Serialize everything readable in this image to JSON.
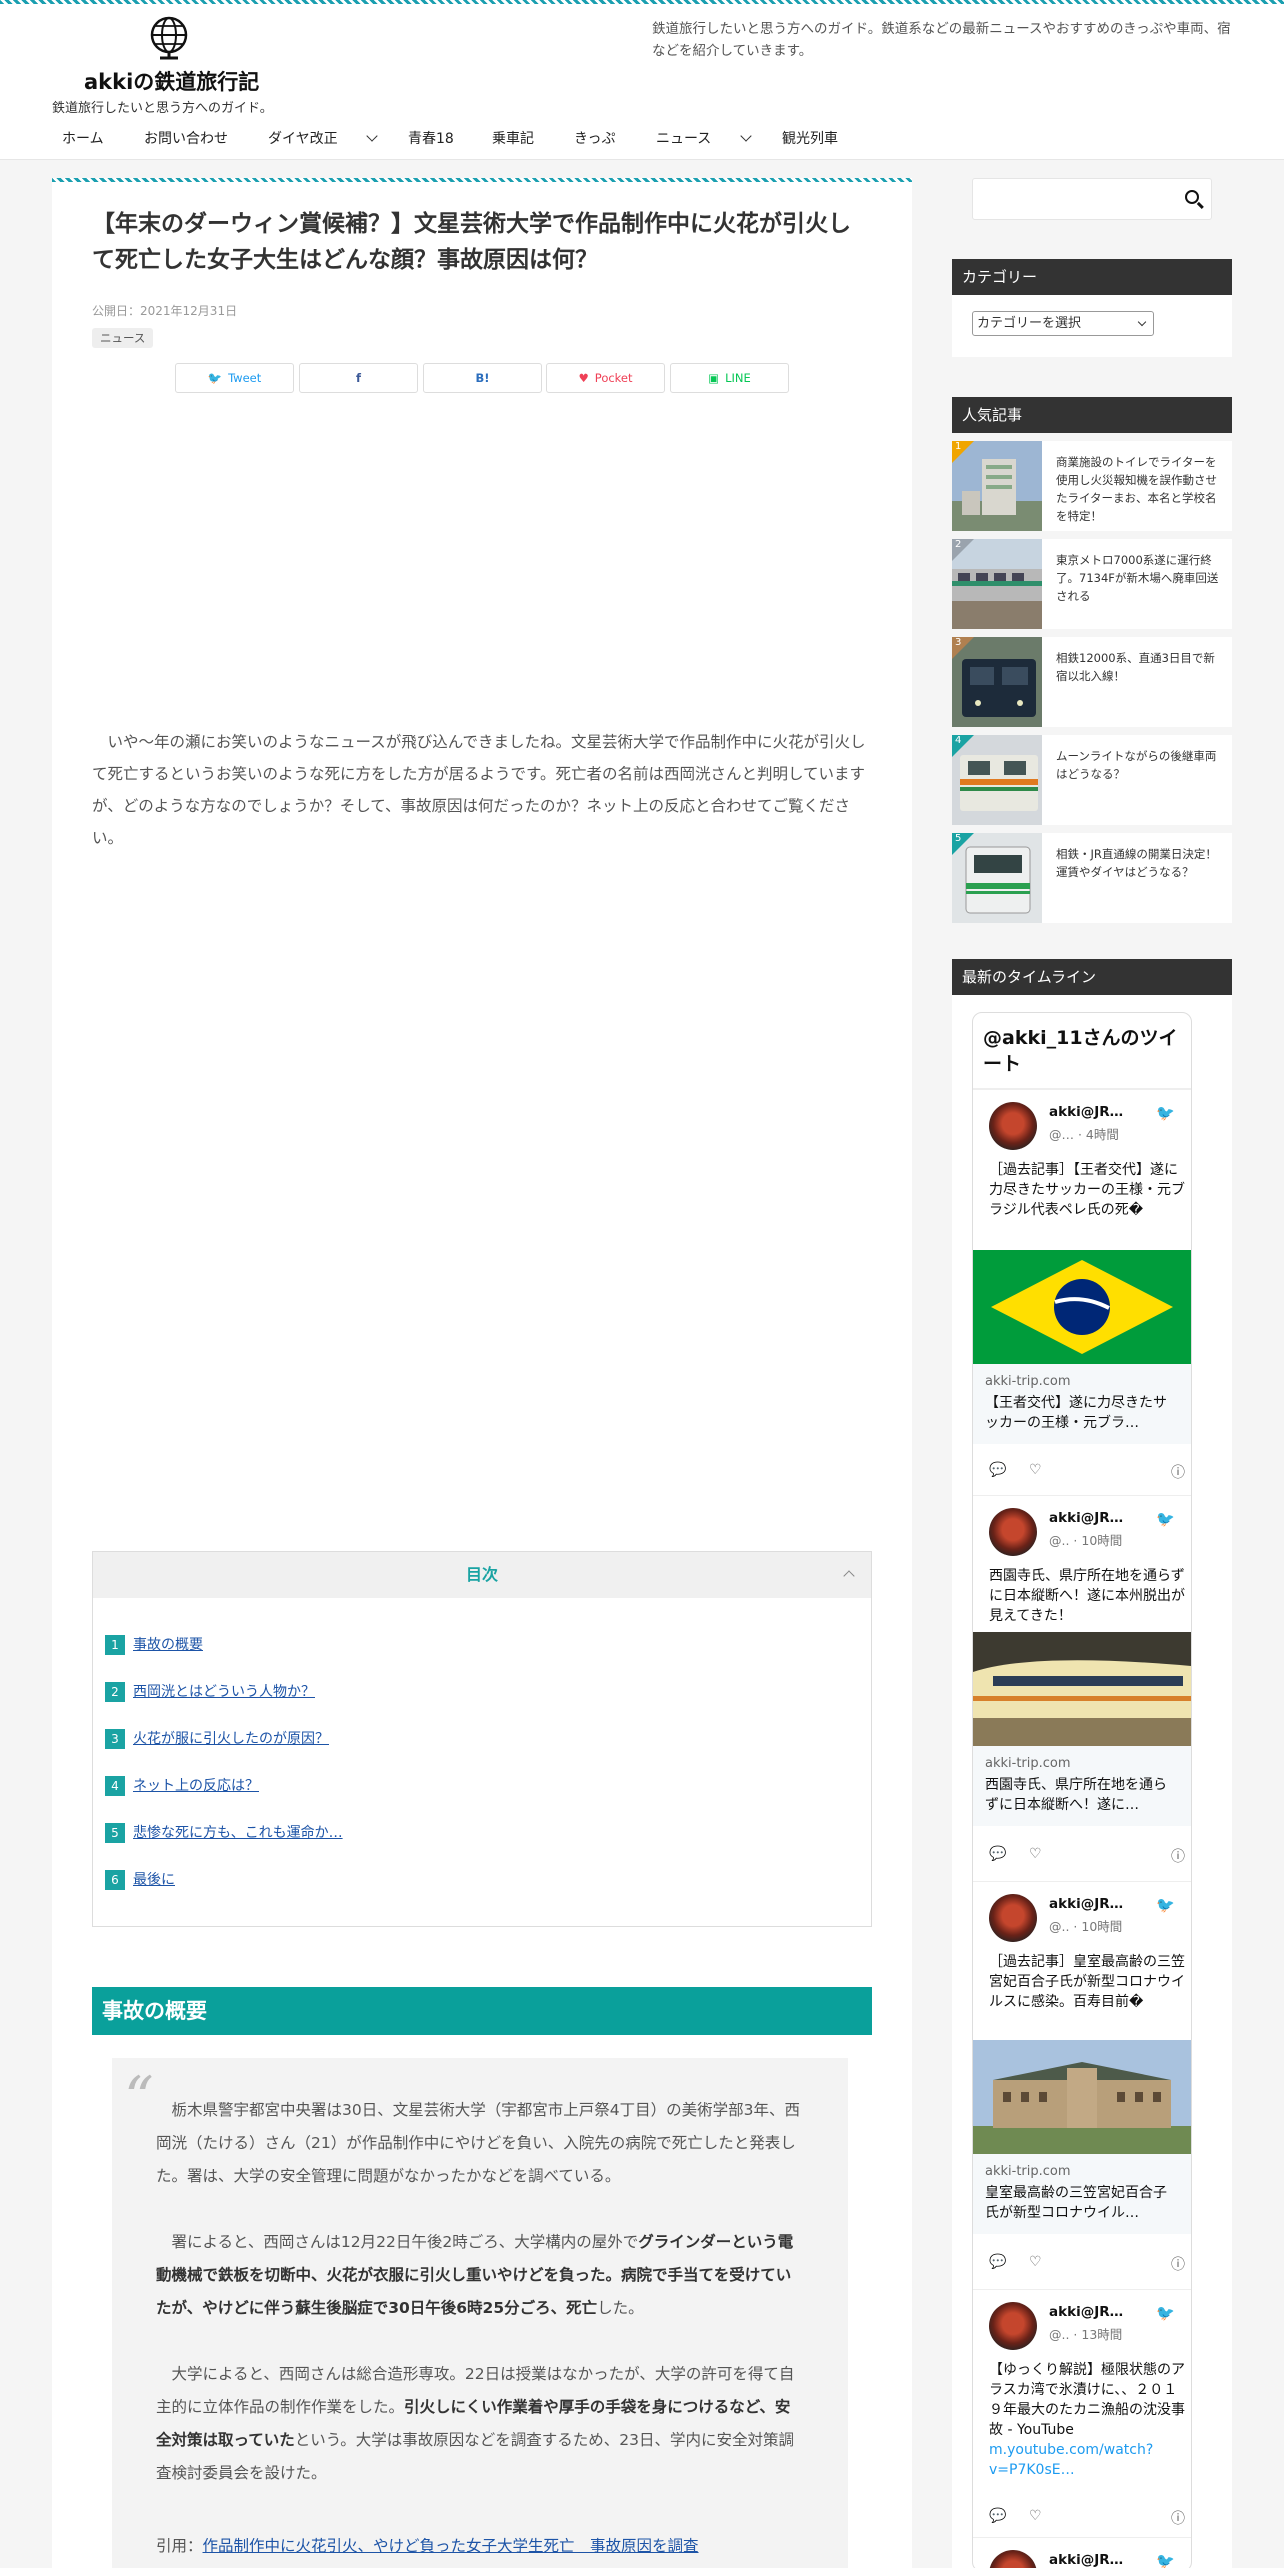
{
  "header": {
    "site_title": "akkiの鉄道旅行記",
    "tagline": "鉄道旅行したいと思う方へのガイド。",
    "description": "鉄道旅行したいと思う方へのガイド。鉄道系などの最新ニュースやおすすめのきっぷや車両、宿などを紹介していきます。"
  },
  "nav": {
    "items": [
      "ホーム",
      "お問い合わせ",
      "ダイヤ改正",
      "青春18",
      "乗車記",
      "きっぷ",
      "ニュース",
      "観光列車"
    ]
  },
  "article": {
    "title": "【年末のダーウィン賞候補？】文星芸術大学で作品制作中に火花が引火して死亡した女子大生はどんな顔？事故原因は何？",
    "date": "公開日：2021年12月31日",
    "category": "ニュース",
    "share": [
      "Tweet",
      "",
      "B!",
      "Pocket",
      "LINE"
    ],
    "intro": "いや～年の瀬にお笑いのようなニュースが飛び込んできましたね。文星芸術大学で作品制作中に火花が引火して死亡するというお笑いのような死に方をした方が居るようです。死亡者の名前は西岡洸さんと判明していますが、どのような方なのでしょうか？そして、事故原因は何だったのか？ネット上の反応と合わせてご覧ください。"
  },
  "toc": {
    "title": "目次",
    "items": [
      {
        "num": "1",
        "label": "事故の概要"
      },
      {
        "num": "2",
        "label": "西岡洸とはどういう人物か？"
      },
      {
        "num": "3",
        "label": "火花が服に引火したのが原因？"
      },
      {
        "num": "4",
        "label": "ネット上の反応は？"
      },
      {
        "num": "5",
        "label": "悲惨な死に方も、これも運命か…"
      },
      {
        "num": "6",
        "label": "最後に"
      }
    ]
  },
  "section": {
    "heading": "事故の概要",
    "quote_p1": "栃木県警宇都宮中央署は30日、文星芸術大学（宇都宮市上戸祭4丁目）の美術学部3年、西岡洸（たける）さん（21）が作品制作中にやけどを負い、入院先の病院で死亡したと発表した。署は、大学の安全管理に問題がなかったかなどを調べている。",
    "quote_p2a": "署によると、西岡さんは12月22日午後2時ごろ、大学構内の屋外で",
    "quote_p2b": "グラインダーという電動機械で鉄板を切断中、火花が衣服に引火し重いやけどを負った。病院で手当てを受けていたが、やけどに伴う蘇生後脳症で30日午後6時25分ごろ、死亡",
    "quote_p2c": "した。",
    "quote_p3a": "大学によると、西岡さんは総合造形専攻。22日は授業はなかったが、大学の許可を得て自主的に立体作品の制作作業をした。",
    "quote_p3b": "引火しにくい作業着や厚手の手袋を身につけるなど、安全対策は取っていた",
    "quote_p3c": "という。大学は事故原因などを調査するため、23日、学内に安全対策調査検討委員会を設けた。",
    "cite_prefix": "引用：",
    "cite_link": "作品制作中に火花引火、やけど負った女子大学生死亡　事故原因を調査"
  },
  "sidebar": {
    "category_title": "カテゴリー",
    "category_select": "カテゴリーを選択",
    "popular_title": "人気記事",
    "popular": [
      {
        "rank": "1",
        "text": "商業施設のトイレでライターを使用し火災報知機を誤作動させたライターまお、本名と学校名を特定！"
      },
      {
        "rank": "2",
        "text": "東京メトロ7000系遂に運行終了。7134Fが新木場へ廃車回送される"
      },
      {
        "rank": "3",
        "text": "相鉄12000系、直通3日目で新宿以北入線！"
      },
      {
        "rank": "4",
        "text": "ムーンライトながらの後継車両はどうなる？"
      },
      {
        "rank": "5",
        "text": "相鉄・JR直通線の開業日決定！運賃やダイヤはどうなる？"
      }
    ],
    "timeline_title": "最新のタイムライン",
    "timeline_header": "@akki_11さんのツイート",
    "tweets": [
      {
        "name": "akki@JR…",
        "meta": "@… · 4時間",
        "text": "［過去記事］【王者交代】遂に力尽きたサッカーの王様・元ブラジル代表ペレ氏の死�",
        "domain": "akki-trip.com",
        "card": "【王者交代】遂に力尽きたサッカーの王様・元ブラ…"
      },
      {
        "name": "akki@JR…",
        "meta": "@.. · 10時間",
        "text": "西園寺氏、県庁所在地を通らずに日本縦断へ！遂に本州脱出が見えてきた！",
        "domain": "akki-trip.com",
        "card": "西園寺氏、県庁所在地を通らずに日本縦断へ！遂に…"
      },
      {
        "name": "akki@JR…",
        "meta": "@.. · 10時間",
        "text": "［過去記事］皇室最高齢の三笠宮妃百合子氏が新型コロナウイルスに感染。百寿目前�",
        "domain": "akki-trip.com",
        "card": "皇室最高齢の三笠宮妃百合子氏が新型コロナウイル…"
      },
      {
        "name": "akki@JR…",
        "meta": "@.. · 13時間",
        "text": "【ゆっくり解説】極限状態のアラスカ湾で氷漬けに、、２０１９年最大のたカニ漁船の沈没事故 - YouTube",
        "link": "m.youtube.com/watch?v=P7K0sE…"
      },
      {
        "name": "akki@JR…",
        "meta": ""
      }
    ]
  }
}
